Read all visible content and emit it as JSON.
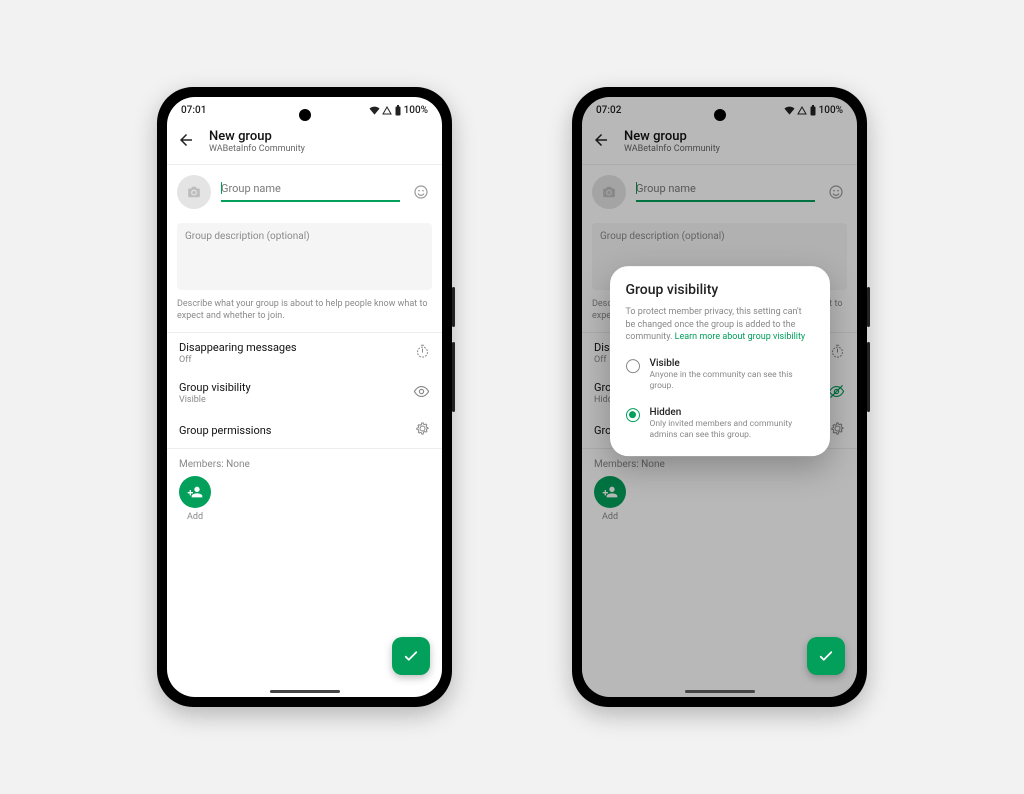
{
  "status": {
    "time_a": "07:01",
    "time_b": "07:02",
    "battery": "100%"
  },
  "header": {
    "title": "New group",
    "subtitle": "WABetaInfo Community"
  },
  "name": {
    "placeholder": "Group name"
  },
  "desc": {
    "placeholder": "Group description (optional)",
    "help": "Describe what your group is about to help people know what to expect and whether to join."
  },
  "rows": {
    "disappearing": {
      "title": "Disappearing messages",
      "value": "Off"
    },
    "visibility_a": {
      "title": "Group visibility",
      "value": "Visible"
    },
    "visibility_b": {
      "title": "Group visibility",
      "value": "Hidden"
    },
    "permissions": {
      "title": "Group permissions"
    }
  },
  "members": {
    "label": "Members: None",
    "add": "Add"
  },
  "modal": {
    "title": "Group visibility",
    "desc": "To protect member privacy, this setting can't be changed once the group is added to the community. ",
    "link": "Learn more about group visibility",
    "opt_visible": {
      "title": "Visible",
      "desc": "Anyone in the community can see this group."
    },
    "opt_hidden": {
      "title": "Hidden",
      "desc": "Only invited members and community admins can see this group."
    }
  },
  "icons": {
    "back": "back-arrow-icon",
    "camera": "camera-icon",
    "emoji": "emoji-icon",
    "timer": "timer-icon",
    "eye": "eye-icon",
    "eye_off": "eye-off-icon",
    "gear": "gear-icon",
    "add_person": "add-person-icon",
    "check": "check-icon",
    "wifi": "wifi-icon",
    "signal": "signal-icon",
    "battery": "battery-icon"
  }
}
